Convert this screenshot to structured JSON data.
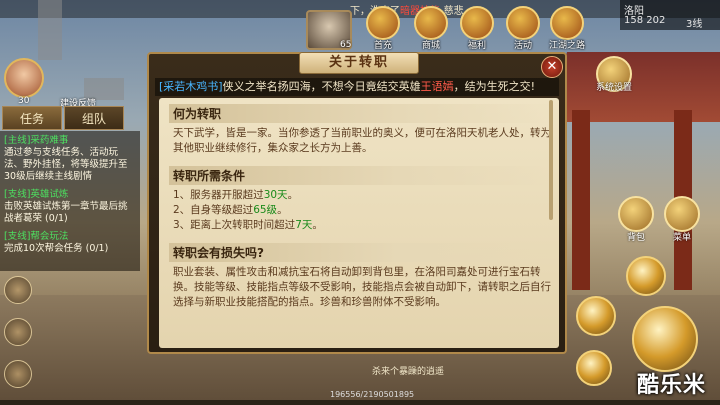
{
  "top": {
    "news_prefix": "下，洗出了",
    "news_highlight": "暗器技能",
    "news_suffix": "-慈悲",
    "menu": [
      {
        "label": "首充",
        "icon": "first-charge-icon"
      },
      {
        "label": "商城",
        "icon": "shop-icon"
      },
      {
        "label": "福利",
        "icon": "welfare-icon"
      },
      {
        "label": "活动",
        "icon": "activity-icon"
      },
      {
        "label": "江湖之路",
        "icon": "jianghu-road-icon"
      }
    ],
    "npc_level": "65",
    "map": {
      "name": "洛阳",
      "coords": "158 202",
      "line": "3线"
    }
  },
  "player": {
    "level": "30",
    "build_label": "建设反馈"
  },
  "tabs": {
    "task": "任务",
    "team": "组队"
  },
  "quests": [
    {
      "tag": "[主线]",
      "title": "采药难事",
      "body": "通过参与支线任务、活动玩法、野外挂怪，将等级提升至30级后继续主线剧情"
    },
    {
      "tag": "[支线]",
      "title": "英雄试炼",
      "body": "击败英雄试炼第一章节最后挑战者葛荣 (0/1)"
    },
    {
      "tag": "[支线]",
      "title": "帮会玩法",
      "body": "完成10次帮会任务 (0/1)"
    }
  ],
  "right": {
    "settings_label": "系统设置",
    "bag_label": "背包",
    "menu_label": "菜单"
  },
  "dialog": {
    "title": "关于转职",
    "banner": {
      "tag": "[采若木鸡书]",
      "pre": "侠义之举名扬四海，不想今日竟结交英雄",
      "name": "王语嫣",
      "post": "，结为生死之交!"
    },
    "sections": {
      "what": {
        "title": "何为转职",
        "body": "天下武学，皆是一家。当你参透了当前职业的奥义，便可在洛阳天机老人处，转为其他职业继续修行，集众家之长方为上善。"
      },
      "req": {
        "title": "转职所需条件",
        "items": [
          {
            "pre": "1、服务器开服超过",
            "hl": "30天",
            "post": "。"
          },
          {
            "pre": "2、自身等级超过",
            "hl": "65级",
            "post": "。"
          },
          {
            "pre": "3、距离上次转职时间超过",
            "hl": "7天",
            "post": "。"
          }
        ]
      },
      "loss": {
        "title": "转职会有损失吗?",
        "body": "职业套装、属性攻击和减抗宝石将自动卸到背包里，在洛阳司嘉处可进行宝石转换。技能等级、技能指点等级不受影响，技能指点会被自动卸下，请转职之后自行选择与新职业技能搭配的指点。珍兽和珍兽附体不受影响。"
      }
    }
  },
  "chat_text": "杀来个暴躁的逍遥",
  "exp_text": "196556/2190501895",
  "exp_fraction": 0.0001,
  "watermark": "酷乐米"
}
